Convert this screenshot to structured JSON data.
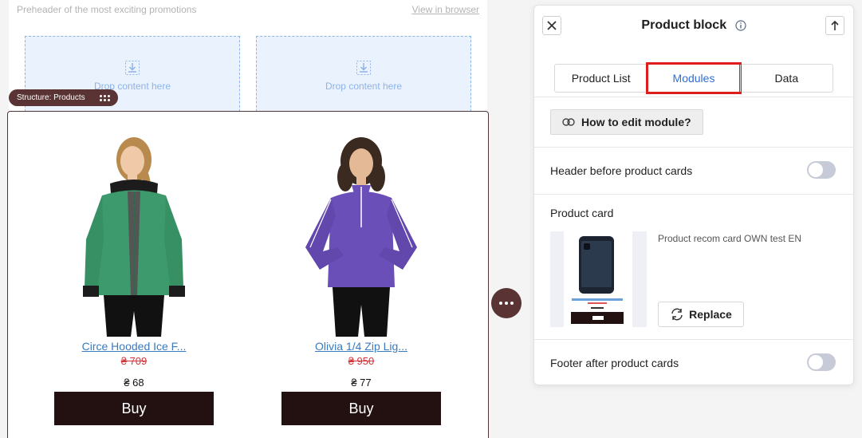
{
  "email": {
    "preheader": "Preheader of the most exciting promotions",
    "view_in_browser": "View in browser",
    "drop_zones": [
      "Drop content here",
      "Drop content here"
    ],
    "structure_tag": "Structure: Products",
    "products": [
      {
        "name": "Circe Hooded Ice F...",
        "old_price": "₴ 709",
        "new_price": "₴ 68",
        "buy_label": "Buy",
        "image": "green-hoodie-woman"
      },
      {
        "name": "Olivia 1/4 Zip Lig...",
        "old_price": "₴ 950",
        "new_price": "₴ 77",
        "buy_label": "Buy",
        "image": "purple-zip-jacket-woman"
      }
    ]
  },
  "panel": {
    "title": "Product block",
    "tabs": [
      {
        "label": "Product List",
        "active": false
      },
      {
        "label": "Modules",
        "active": true
      },
      {
        "label": "Data",
        "active": false
      }
    ],
    "how_to_edit": "How to edit module?",
    "header_toggle_label": "Header before product cards",
    "header_toggle_on": false,
    "product_card_label": "Product card",
    "product_card_name": "Product recom card OWN test EN",
    "replace_label": "Replace",
    "footer_toggle_label": "Footer after product cards",
    "footer_toggle_on": false
  },
  "colors": {
    "accent_blue": "#2f6fd6",
    "highlight_red": "#e01d1d",
    "buy_button": "#231111",
    "structure_brown": "#5a3434",
    "price_red": "#d3333a",
    "link_blue": "#3a7bbf"
  }
}
